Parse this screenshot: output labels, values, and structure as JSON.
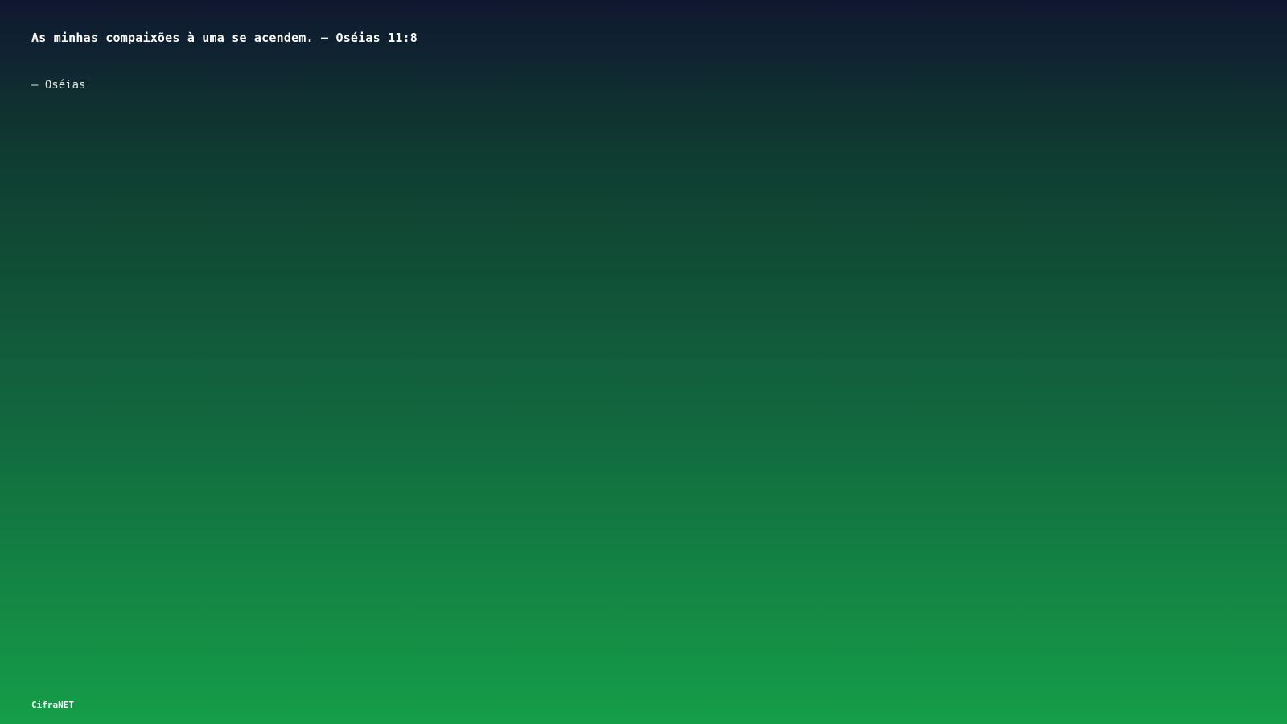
{
  "quote": {
    "text": "As minhas compaixões à uma se acendem. — Oséias 11:8",
    "attribution": "— Oséias"
  },
  "footer": {
    "brand": "CifraNET"
  },
  "colors": {
    "gradient_top": "#0f1730",
    "gradient_bottom": "#159e48",
    "text": "#ffffff"
  }
}
